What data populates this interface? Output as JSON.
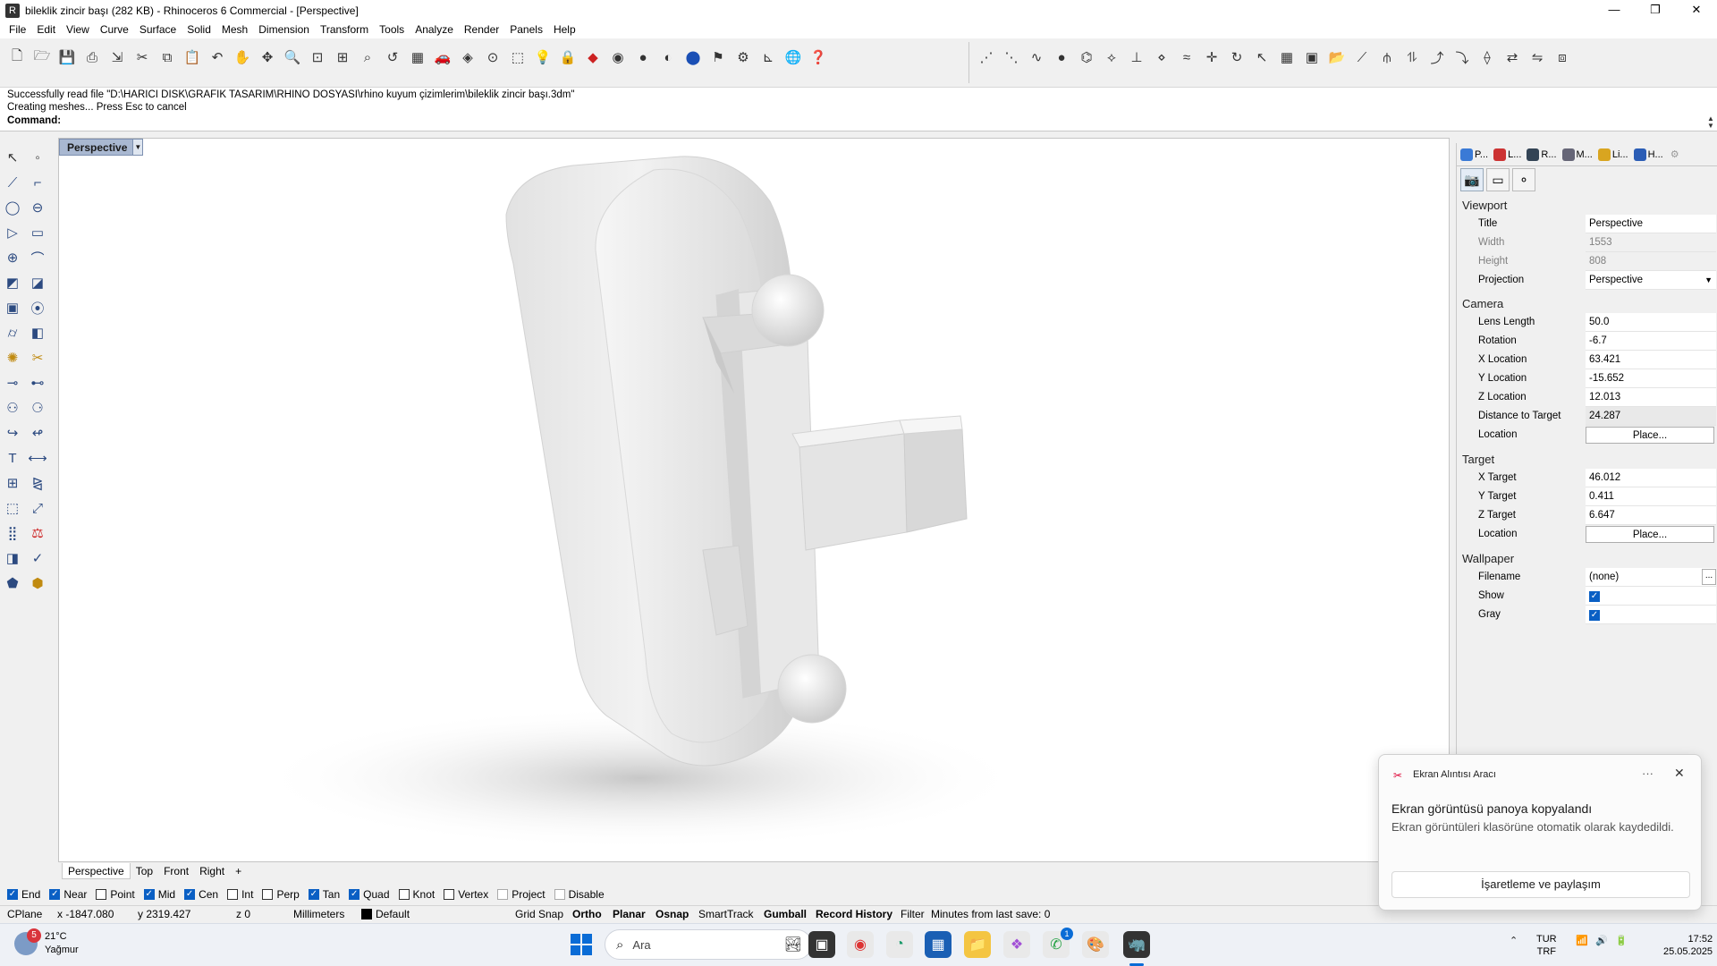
{
  "window": {
    "title": "bileklik zincir başı (282 KB) - Rhinoceros 6 Commercial - [Perspective]",
    "app_icon": "rhino-icon",
    "minimize": "—",
    "maximize": "❐",
    "close": "✕"
  },
  "menu": [
    "File",
    "Edit",
    "View",
    "Curve",
    "Surface",
    "Solid",
    "Mesh",
    "Dimension",
    "Transform",
    "Tools",
    "Analyze",
    "Render",
    "Panels",
    "Help"
  ],
  "command": {
    "line1": "Successfully read file \"D:\\HARICI DISK\\GRAFIK TASARIM\\RHINO DOSYASI\\rhino kuyum çizimlerim\\bileklik zincir başı.3dm\"",
    "line2": "Creating meshes... Press Esc to cancel",
    "prompt": "Command:"
  },
  "viewport": {
    "active_title": "Perspective",
    "model_color": "#e6e6e6"
  },
  "view_tabs": [
    "Perspective",
    "Top",
    "Front",
    "Right",
    "+"
  ],
  "osnaps": [
    {
      "label": "End",
      "checked": true
    },
    {
      "label": "Near",
      "checked": true
    },
    {
      "label": "Point",
      "checked": false
    },
    {
      "label": "Mid",
      "checked": true
    },
    {
      "label": "Cen",
      "checked": true
    },
    {
      "label": "Int",
      "checked": false
    },
    {
      "label": "Perp",
      "checked": false
    },
    {
      "label": "Tan",
      "checked": true
    },
    {
      "label": "Quad",
      "checked": true
    },
    {
      "label": "Knot",
      "checked": false
    },
    {
      "label": "Vertex",
      "checked": false
    },
    {
      "label": "Project",
      "checked": false
    },
    {
      "label": "Disable",
      "checked": false
    }
  ],
  "status": {
    "cplane": "CPlane",
    "x": "x -1847.080",
    "y": "y 2319.427",
    "z": "z 0",
    "units": "Millimeters",
    "layer": "Default",
    "grid_snap": "Grid Snap",
    "ortho": "Ortho",
    "planar": "Planar",
    "osnap": "Osnap",
    "smarttrack": "SmartTrack",
    "gumball": "Gumball",
    "record_history": "Record History",
    "filter": "Filter",
    "last_save": "Minutes from last save: 0"
  },
  "panel": {
    "tabs": [
      "P...",
      "L...",
      "R...",
      "M...",
      "Li...",
      "H..."
    ],
    "sections": {
      "viewport": "Viewport",
      "camera": "Camera",
      "target": "Target",
      "wallpaper": "Wallpaper"
    },
    "viewport_props": {
      "title_label": "Title",
      "title_value": "Perspective",
      "width_label": "Width",
      "width_value": "1553",
      "height_label": "Height",
      "height_value": "808",
      "projection_label": "Projection",
      "projection_value": "Perspective"
    },
    "camera_props": {
      "lens_label": "Lens Length",
      "lens_value": "50.0",
      "rotation_label": "Rotation",
      "rotation_value": "-6.7",
      "xloc_label": "X Location",
      "xloc_value": "63.421",
      "yloc_label": "Y Location",
      "yloc_value": "-15.652",
      "zloc_label": "Z Location",
      "zloc_value": "12.013",
      "dist_label": "Distance to Target",
      "dist_value": "24.287",
      "loc_label": "Location",
      "loc_button": "Place..."
    },
    "target_props": {
      "xt_label": "X Target",
      "xt_value": "46.012",
      "yt_label": "Y Target",
      "yt_value": "0.411",
      "zt_label": "Z Target",
      "zt_value": "6.647",
      "loc_label": "Location",
      "loc_button": "Place..."
    },
    "wallpaper_props": {
      "filename_label": "Filename",
      "filename_value": "(none)",
      "filename_button": "...",
      "show_label": "Show",
      "show_checked": true,
      "gray_label": "Gray",
      "gray_checked": true
    }
  },
  "toast": {
    "app": "Ekran Alıntısı Aracı",
    "more": "···",
    "close": "✕",
    "headline": "Ekran görüntüsü panoya kopyalandı",
    "body": "Ekran görüntüleri klasörüne otomatik olarak kaydedildi.",
    "action": "İşaretleme ve paylaşım"
  },
  "taskbar": {
    "weather_badge": "5",
    "temperature": "21°C",
    "condition": "Yağmur",
    "search_placeholder": "Ara",
    "whatsapp_badge": "1",
    "lang_line1": "TUR",
    "lang_line2": "TRF",
    "time": "17:52",
    "date": "25.05.2025"
  }
}
